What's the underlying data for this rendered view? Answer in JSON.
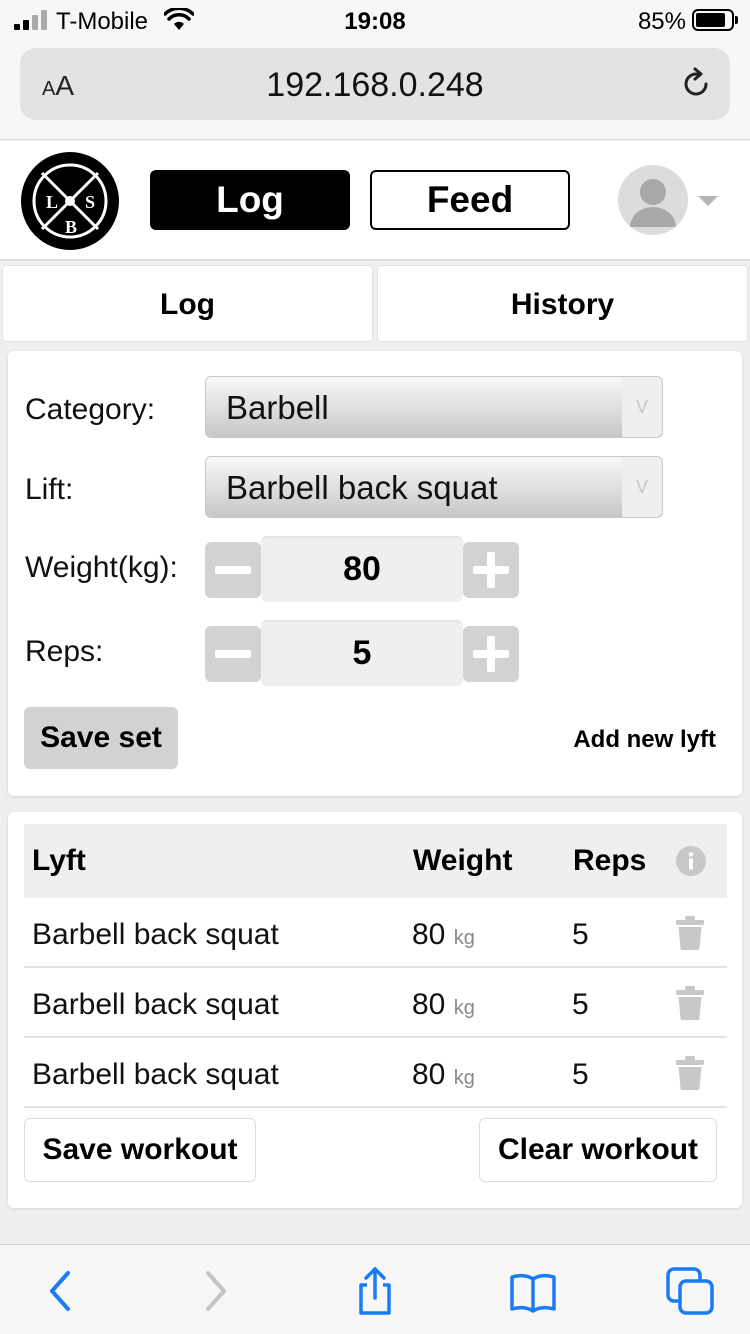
{
  "status_bar": {
    "carrier": "T-Mobile",
    "time": "19:08",
    "battery_percent": "85%",
    "battery_level": 0.85
  },
  "browser": {
    "text_size_label_small": "A",
    "text_size_label_large": "A",
    "url": "192.168.0.248"
  },
  "header": {
    "logo_letters": [
      "L",
      "S",
      "B"
    ],
    "nav": {
      "log_label": "Log",
      "feed_label": "Feed"
    }
  },
  "tabs": {
    "log_label": "Log",
    "history_label": "History"
  },
  "form": {
    "category_label": "Category:",
    "category_value": "Barbell",
    "lift_label": "Lift:",
    "lift_value": "Barbell back squat",
    "weight_label": "Weight(kg):",
    "weight_value": "80",
    "reps_label": "Reps:",
    "reps_value": "5",
    "save_set_label": "Save set",
    "add_new_lyft_label": "Add new lyft"
  },
  "workout_table": {
    "headers": {
      "lyft": "Lyft",
      "weight": "Weight",
      "reps": "Reps"
    },
    "rows": [
      {
        "lyft": "Barbell back squat",
        "weight": "80",
        "unit": "kg",
        "reps": "5"
      },
      {
        "lyft": "Barbell back squat",
        "weight": "80",
        "unit": "kg",
        "reps": "5"
      },
      {
        "lyft": "Barbell back squat",
        "weight": "80",
        "unit": "kg",
        "reps": "5"
      }
    ],
    "save_workout_label": "Save workout",
    "clear_workout_label": "Clear workout"
  },
  "colors": {
    "accent_blue": "#1a7cf5",
    "primary_black": "#000000",
    "button_gray": "#d2d2d2",
    "icon_gray": "#c8c8c8"
  },
  "icons": {
    "toolbar": [
      "back-icon",
      "forward-icon",
      "share-icon",
      "bookmarks-icon",
      "tabs-icon"
    ]
  }
}
